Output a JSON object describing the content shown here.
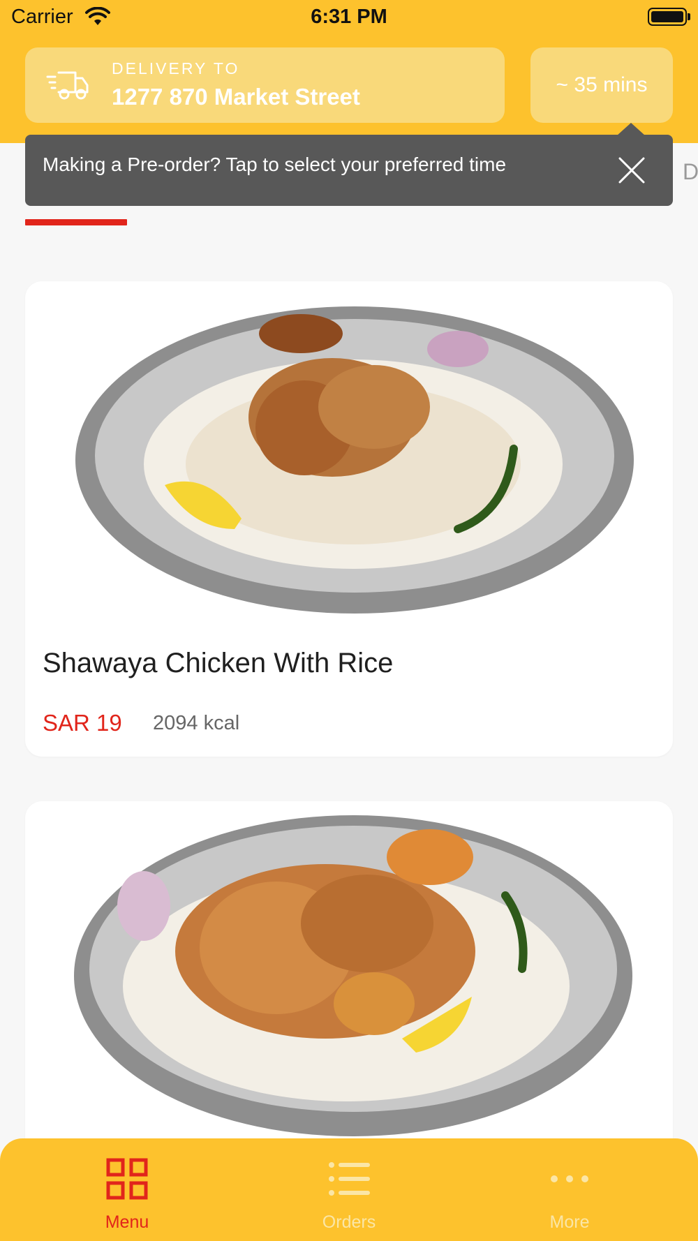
{
  "status_bar": {
    "carrier": "Carrier",
    "time": "6:31 PM"
  },
  "header": {
    "delivery_label": "DELIVERY TO",
    "delivery_address": "1277 870 Market Street",
    "eta": "~ 35 mins"
  },
  "tooltip": {
    "text": "Making a Pre-order? Tap to select your preferred time"
  },
  "tab_partial": "D",
  "menu_items": [
    {
      "name": "Shawaya Chicken With Rice",
      "price": "SAR 19",
      "calories": "2094 kcal"
    },
    {
      "name": "",
      "price": "",
      "calories": ""
    }
  ],
  "nav": {
    "menu": "Menu",
    "orders": "Orders",
    "more": "More"
  },
  "colors": {
    "brand_yellow": "#fdc22d",
    "accent_red": "#e1251b",
    "tooltip_gray": "#585858"
  },
  "icons": [
    "wifi-icon",
    "battery-icon",
    "truck-icon",
    "close-icon",
    "grid-icon",
    "list-icon",
    "more-dots-icon"
  ]
}
